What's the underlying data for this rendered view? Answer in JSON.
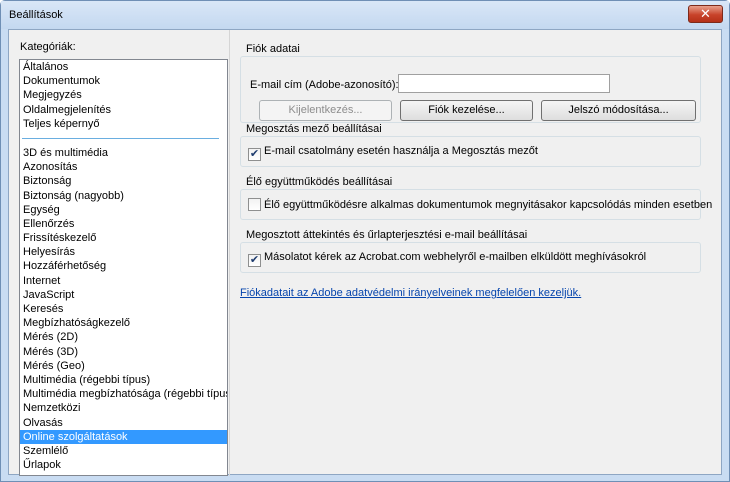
{
  "window": {
    "title": "Beállítások",
    "close_glyph": "✕"
  },
  "categories": {
    "label": "Kategóriák:",
    "group1": [
      "Általános",
      "Dokumentumok",
      "Megjegyzés",
      "Oldalmegjelenítés",
      "Teljes képernyő"
    ],
    "group2": [
      "3D és multimédia",
      "Azonosítás",
      "Biztonság",
      "Biztonság (nagyobb)",
      "Egység",
      "Ellenőrzés",
      "Frissítéskezelő",
      "Helyesírás",
      "Hozzáférhetőség",
      "Internet",
      "JavaScript",
      "Keresés",
      "Megbízhatóságkezelő",
      "Mérés (2D)",
      "Mérés (3D)",
      "Mérés (Geo)",
      "Multimédia (régebbi típus)",
      "Multimédia megbízhatósága (régebbi típus)",
      "Nemzetközi",
      "Olvasás",
      "Online szolgáltatások",
      "Szemlélő",
      "Űrlapok"
    ],
    "selected": "Online szolgáltatások"
  },
  "account": {
    "title": "Fiók adatai",
    "email_label": "E-mail cím (Adobe-azonosító):",
    "email_value": "",
    "login_button": "Kijelentkezés...",
    "manage_button": "Fiók kezelése...",
    "password_button": "Jelszó módosítása..."
  },
  "sharing": {
    "title": "Megosztás mező beállításai",
    "checkbox_label": "E-mail csatolmány esetén használja a Megosztás mezőt",
    "checked": true
  },
  "live": {
    "title": "Élő együttműködés beállításai",
    "checkbox_label": "Élő együttműködésre alkalmas dokumentumok megnyitásakor kapcsolódás minden esetben",
    "checked": false
  },
  "review": {
    "title": "Megosztott áttekintés és űrlapterjesztési e-mail beállításai",
    "checkbox_label": "Másolatot kérek az Acrobat.com webhelyről e-mailben elküldött meghívásokról",
    "checked": true
  },
  "privacy_link": "Fiókadatait az Adobe adatvédelmi irányelveinek megfelelően kezeljük.",
  "check_glyph": "✔"
}
